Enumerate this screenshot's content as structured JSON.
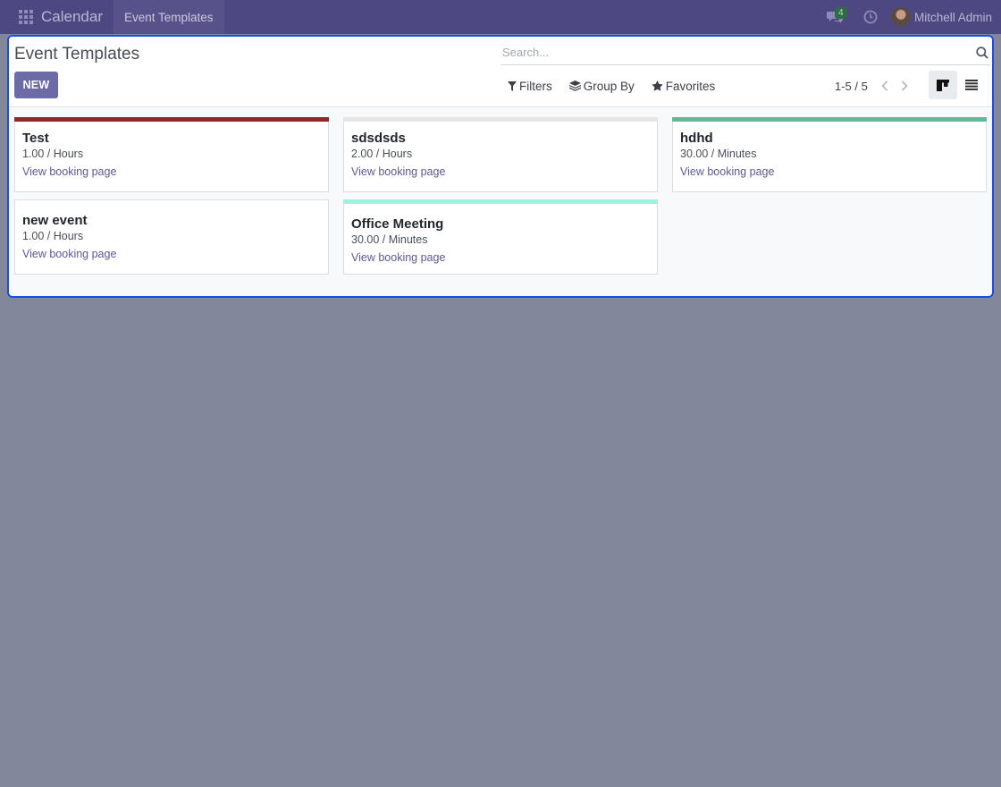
{
  "navbar": {
    "app_icon": "apps-grid-icon",
    "app_title": "Calendar",
    "menu_item": "Event Templates",
    "chat_icon": "chat-icon",
    "chat_badge": "4",
    "activity_icon": "clock-icon",
    "user_name": "Mitchell Admin"
  },
  "control_panel": {
    "title": "Event Templates",
    "new_button": "NEW",
    "search_placeholder": "Search...",
    "filters_label": "Filters",
    "group_by_label": "Group By",
    "favorites_label": "Favorites",
    "pager_value": "1-5 / 5",
    "active_view": "kanban"
  },
  "cards": [
    {
      "name": "Test",
      "duration": "1.00 / Hours",
      "link": "View booking page",
      "color": "#8c2a2a"
    },
    {
      "name": "sdsdsds",
      "duration": "2.00 / Hours",
      "link": "View booking page",
      "color": "#e6e6e6"
    },
    {
      "name": "hdhd",
      "duration": "30.00 / Minutes",
      "link": "View booking page",
      "color": "#5dbb99"
    },
    {
      "name": "new event",
      "duration": "1.00 / Hours",
      "link": "View booking page",
      "color": ""
    },
    {
      "name": "Office Meeting",
      "duration": "30.00 / Minutes",
      "link": "View booking page",
      "color": "#9ff0dc"
    }
  ],
  "colors": {
    "navbar_bg": "#4d4881",
    "primary_button": "#6d6aa8",
    "backdrop": "#83879b",
    "focus_border": "#1c4de6"
  }
}
